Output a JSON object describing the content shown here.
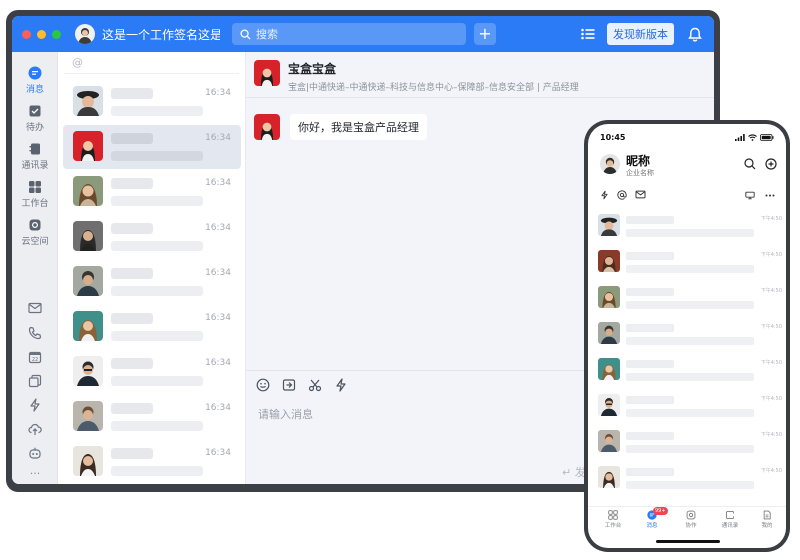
{
  "titlebar": {
    "signature": "这是一个工作签名这是…",
    "search_placeholder": "搜索",
    "plus_symbol": "+",
    "new_version": "发现新版本",
    "traffic_colors": [
      "#ff5f57",
      "#ffbd2e",
      "#28c840"
    ],
    "accent": "#2b7bf6"
  },
  "rail": {
    "items": [
      {
        "label": "消息",
        "icon": "message-icon"
      },
      {
        "label": "待办",
        "icon": "todo-icon"
      },
      {
        "label": "通讯录",
        "icon": "contacts-icon"
      },
      {
        "label": "工作台",
        "icon": "workbench-icon"
      },
      {
        "label": "云空间",
        "icon": "cloud-space-icon"
      }
    ],
    "more": "..."
  },
  "conv_list": {
    "at_symbol": "@",
    "items": [
      {
        "time": "16:34"
      },
      {
        "time": "16:34"
      },
      {
        "time": "16:34"
      },
      {
        "time": "16:34"
      },
      {
        "time": "16:34"
      },
      {
        "time": "16:34"
      },
      {
        "time": "16:34"
      },
      {
        "time": "16:34"
      },
      {
        "time": "16:34"
      }
    ]
  },
  "chat": {
    "name": "宝盒宝盒",
    "subtitle": "宝盒|中通快递–中通快递–科技与信息中心–保障部–信息安全部 | 产品经理",
    "message": "你好，我是宝盒产品经理",
    "input_placeholder": "请输入消息",
    "send_hint": "↵ 发"
  },
  "phone": {
    "status_time": "10:45",
    "nickname": "昵称",
    "org": "企业名称",
    "items": [
      {
        "time": "下午4:50"
      },
      {
        "time": "下午4:50"
      },
      {
        "time": "下午4:50"
      },
      {
        "time": "下午4:50"
      },
      {
        "time": "下午4:50"
      },
      {
        "time": "下午4:50"
      },
      {
        "time": "下午4:50"
      },
      {
        "time": "下午4:50"
      }
    ],
    "tabs": [
      {
        "label": "工作台"
      },
      {
        "label": "消息",
        "badge": "99+"
      },
      {
        "label": "协作"
      },
      {
        "label": "通讯录"
      },
      {
        "label": "我的"
      }
    ]
  }
}
